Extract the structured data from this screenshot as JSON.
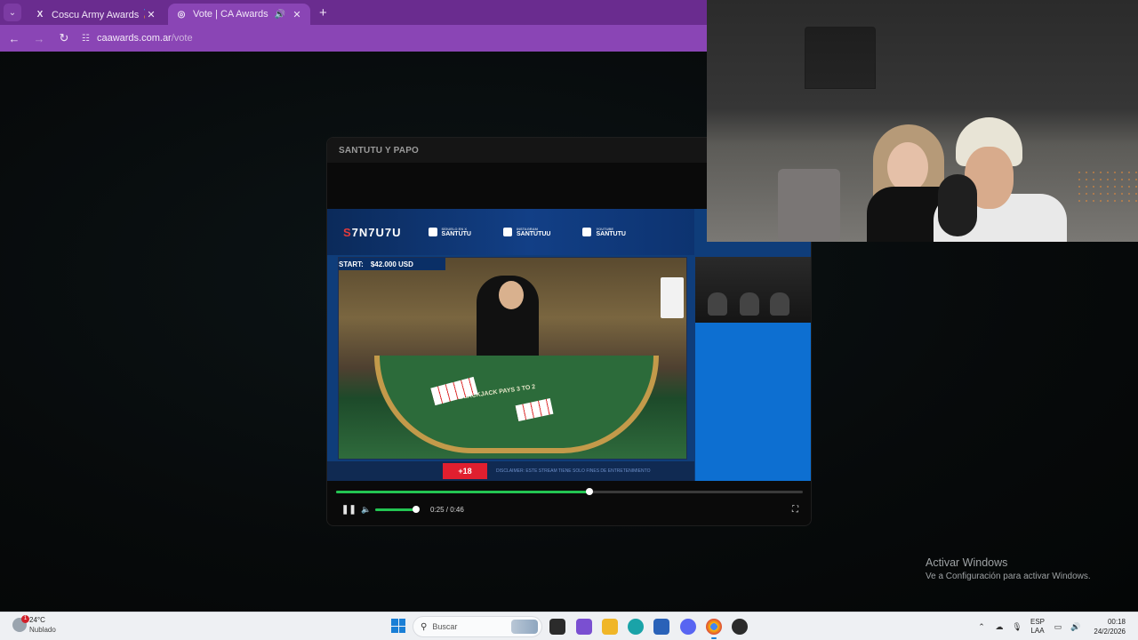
{
  "browser": {
    "tabs": [
      {
        "favicon": "x-icon",
        "title": "Coscu Army Awards 🏅 on X: \"",
        "active": false
      },
      {
        "favicon": "caawards-icon",
        "title": "Vote | CA Awards",
        "active": true,
        "audio": true
      }
    ],
    "address": {
      "domain": "caawards.com.ar",
      "path": "/vote"
    }
  },
  "modal": {
    "title": "SANTUTU Y PAPO",
    "video": {
      "logo_pre": "S",
      "logo_mid": "7N7U7U",
      "socials": [
        {
          "icon": "x-icon",
          "caption": "SÍGUELO EN X",
          "handle": "SANTUTU"
        },
        {
          "icon": "instagram-icon",
          "caption": "INSTAGRAM",
          "handle": "SANTUTUU"
        },
        {
          "icon": "youtube-icon",
          "caption": "YOUTUBE",
          "handle": "SANTUTU"
        }
      ],
      "start_label": "START:",
      "start_value": "$42.000 USD",
      "table_text": "BLACKJACK PAYS 3 TO 2",
      "age_badge": "+18",
      "disclaimer": "DISCLAIMER: ESTE STREAM TIENE SOLO FINES DE ENTRETENIMIENTO"
    },
    "player": {
      "progress_fraction": 0.543,
      "volume_fraction": 0.92,
      "time": "0:25 / 0:46"
    }
  },
  "watermark": {
    "title": "Activar Windows",
    "subtitle": "Ve a Configuración para activar Windows."
  },
  "taskbar": {
    "weather_temp": "24°C",
    "weather_cond": "Nublado",
    "weather_badge": "1",
    "search_placeholder": "Buscar",
    "apps": [
      {
        "name": "task-view-icon",
        "color": "#2b2b2b"
      },
      {
        "name": "copilot-icon",
        "color": "#7a4fd1"
      },
      {
        "name": "file-explorer-icon",
        "color": "#f0b628"
      },
      {
        "name": "edge-icon",
        "color": "#1aa3a8"
      },
      {
        "name": "store-icon",
        "color": "#2a62b8"
      },
      {
        "name": "discord-icon",
        "color": "#5865f2"
      },
      {
        "name": "chrome-icon",
        "color": "#dd4b39"
      },
      {
        "name": "obs-icon",
        "color": "#2b2b2b"
      }
    ],
    "lang_top": "ESP",
    "lang_bottom": "LAA",
    "time": "00:18",
    "date": "24/2/2026"
  }
}
